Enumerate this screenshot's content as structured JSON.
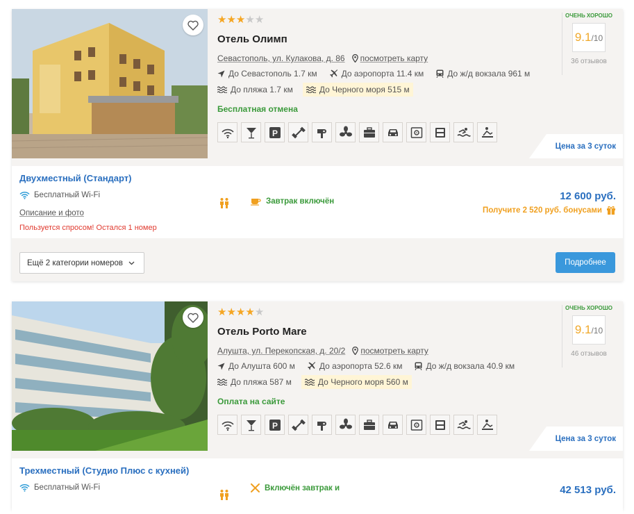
{
  "hotels": [
    {
      "stars": 3,
      "name": "Отель Олимп",
      "address": "Севастополь, ул. Кулакова, д. 86",
      "map_label": "посмотреть карту",
      "to_city": "До Севастополь 1.7 км",
      "to_airport": "До аэропорта 11.4 км",
      "to_station": "До ж/д вокзала 961 м",
      "to_beach": "До пляжа 1.7 км",
      "to_sea": "До Черного моря 515 м",
      "policy": "Бесплатная отмена",
      "rating_label": "ОЧЕНЬ ХОРОШО",
      "rating": "9.1",
      "rating_max": "/10",
      "reviews": "36 отзывов",
      "price_period": "Цена за 3 суток",
      "room_name": "Двухместный (Стандарт)",
      "wifi": "Бесплатный Wi-Fi",
      "description_link": "Описание и фото",
      "demand": "Пользуется спросом! Остался 1 номер",
      "breakfast": "Завтрак включён",
      "price": "12 600 руб.",
      "bonus": "Получите 2 520 руб. бонусами",
      "more_categories": "Ещё 2 категории номеров",
      "details_button": "Подробнее"
    },
    {
      "stars": 4,
      "name": "Отель Porto Mare",
      "address": "Алушта, ул. Перекопская, д. 20/2",
      "map_label": "посмотреть карту",
      "to_city": "До Алушта 600 м",
      "to_airport": "До аэропорта 52.6 км",
      "to_station": "До ж/д вокзала 40.9 км",
      "to_beach": "До пляжа 587 м",
      "to_sea": "До Черного моря 560 м",
      "policy": "Оплата на сайте",
      "rating_label": "ОЧЕНЬ ХОРОШО",
      "rating": "9.1",
      "rating_max": "/10",
      "reviews": "46 отзывов",
      "price_period": "Цена за 3 суток",
      "room_name": "Трехместный (Студио Плюс с кухней)",
      "wifi": "Бесплатный Wi-Fi",
      "breakfast": "Включён завтрак и",
      "price": "42 513 руб."
    }
  ],
  "stars_max": 5,
  "amenities": [
    "wifi-icon",
    "bar-icon",
    "parking-icon",
    "gym-icon",
    "hairdryer-icon",
    "fan-icon",
    "business-icon",
    "car-icon",
    "safe-icon",
    "restaurant-icon",
    "pool-icon",
    "spa-icon"
  ],
  "colors": {
    "accent": "#2a6fbf",
    "green": "#3b9a3b",
    "orange": "#f0a020",
    "button": "#3a98dc",
    "star": "#f5a623"
  }
}
